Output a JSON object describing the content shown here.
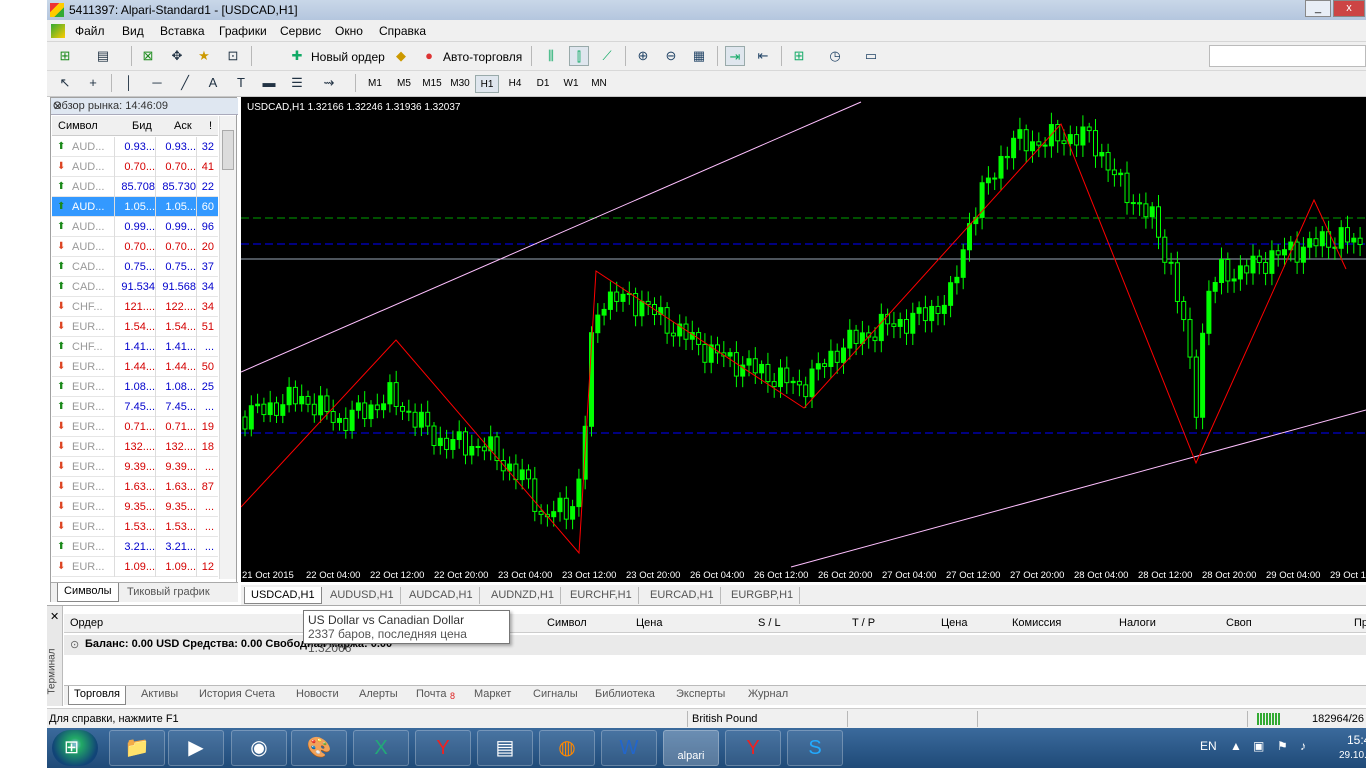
{
  "window": {
    "title": "5411397: Alpari-Standard1 - [USDCAD,H1]",
    "min": "_",
    "close": "x"
  },
  "menu": [
    "Файл",
    "Вид",
    "Вставка",
    "Графики",
    "Сервис",
    "Окно",
    "Справка"
  ],
  "toolbar": {
    "new_order": "Новый ордер",
    "auto_trading": "Авто-торговля"
  },
  "timeframes": [
    "M1",
    "M5",
    "M15",
    "M30",
    "H1",
    "H4",
    "D1",
    "W1",
    "MN"
  ],
  "active_timeframe": "H1",
  "market_watch": {
    "title": "Обзор рынка: 14:46:09",
    "cols": {
      "symbol": "Символ",
      "bid": "Бид",
      "ask": "Аск",
      "spread": "!"
    },
    "rows": [
      {
        "dir": "up",
        "sym": "AUD...",
        "bid": "0.93...",
        "ask": "0.93...",
        "sp": "32",
        "color": "blue"
      },
      {
        "dir": "dn",
        "sym": "AUD...",
        "bid": "0.70...",
        "ask": "0.70...",
        "sp": "41",
        "color": "red"
      },
      {
        "dir": "up",
        "sym": "AUD...",
        "bid": "85.708",
        "ask": "85.730",
        "sp": "22",
        "color": "blue"
      },
      {
        "dir": "up",
        "sym": "AUD...",
        "bid": "1.05...",
        "ask": "1.05...",
        "sp": "60",
        "color": "blue",
        "selected": true
      },
      {
        "dir": "up",
        "sym": "AUD...",
        "bid": "0.99...",
        "ask": "0.99...",
        "sp": "96",
        "color": "blue"
      },
      {
        "dir": "dn",
        "sym": "AUD...",
        "bid": "0.70...",
        "ask": "0.70...",
        "sp": "20",
        "color": "red"
      },
      {
        "dir": "up",
        "sym": "CAD...",
        "bid": "0.75...",
        "ask": "0.75...",
        "sp": "37",
        "color": "blue"
      },
      {
        "dir": "up",
        "sym": "CAD...",
        "bid": "91.534",
        "ask": "91.568",
        "sp": "34",
        "color": "blue"
      },
      {
        "dir": "dn",
        "sym": "CHF...",
        "bid": "121....",
        "ask": "122....",
        "sp": "34",
        "color": "red"
      },
      {
        "dir": "dn",
        "sym": "EUR...",
        "bid": "1.54...",
        "ask": "1.54...",
        "sp": "51",
        "color": "red"
      },
      {
        "dir": "up",
        "sym": "CHF...",
        "bid": "1.41...",
        "ask": "1.41...",
        "sp": "...",
        "color": "blue"
      },
      {
        "dir": "dn",
        "sym": "EUR...",
        "bid": "1.44...",
        "ask": "1.44...",
        "sp": "50",
        "color": "red"
      },
      {
        "dir": "up",
        "sym": "EUR...",
        "bid": "1.08...",
        "ask": "1.08...",
        "sp": "25",
        "color": "blue"
      },
      {
        "dir": "up",
        "sym": "EUR...",
        "bid": "7.45...",
        "ask": "7.45...",
        "sp": "...",
        "color": "blue"
      },
      {
        "dir": "dn",
        "sym": "EUR...",
        "bid": "0.71...",
        "ask": "0.71...",
        "sp": "19",
        "color": "red"
      },
      {
        "dir": "dn",
        "sym": "EUR...",
        "bid": "132....",
        "ask": "132....",
        "sp": "18",
        "color": "red"
      },
      {
        "dir": "dn",
        "sym": "EUR...",
        "bid": "9.39...",
        "ask": "9.39...",
        "sp": "...",
        "color": "red"
      },
      {
        "dir": "dn",
        "sym": "EUR...",
        "bid": "1.63...",
        "ask": "1.63...",
        "sp": "87",
        "color": "red"
      },
      {
        "dir": "dn",
        "sym": "EUR...",
        "bid": "9.35...",
        "ask": "9.35...",
        "sp": "...",
        "color": "red"
      },
      {
        "dir": "dn",
        "sym": "EUR...",
        "bid": "1.53...",
        "ask": "1.53...",
        "sp": "...",
        "color": "red"
      },
      {
        "dir": "up",
        "sym": "EUR...",
        "bid": "3.21...",
        "ask": "3.21...",
        "sp": "...",
        "color": "blue"
      },
      {
        "dir": "dn",
        "sym": "EUR...",
        "bid": "1.09...",
        "ask": "1.09...",
        "sp": "12",
        "color": "red"
      }
    ],
    "tabs": [
      "Символы",
      "Тиковый график"
    ]
  },
  "chart": {
    "header": "USDCAD,H1  1.32166 1.32246 1.31936 1.32037",
    "x_labels": [
      "21 Oct 2015",
      "22 Oct 04:00",
      "22 Oct 12:00",
      "22 Oct 20:00",
      "23 Oct 04:00",
      "23 Oct 12:00",
      "23 Oct 20:00",
      "26 Oct 04:00",
      "26 Oct 12:00",
      "26 Oct 20:00",
      "27 Oct 04:00",
      "27 Oct 12:00",
      "27 Oct 20:00",
      "28 Oct 04:00",
      "28 Oct 12:00",
      "28 Oct 20:00",
      "29 Oct 04:00",
      "29 Oct 1"
    ],
    "colors": {
      "bg": "#000000",
      "candle": "#00ff00",
      "zigzag": "#ff0000",
      "channel": "#ffc0ff",
      "level_green": "#00a000",
      "level_blue": "#0000ff",
      "price_line": "#9aa9b8"
    }
  },
  "chart_tabs": [
    "USDCAD,H1",
    "AUDUSD,H1",
    "AUDCAD,H1",
    "AUDNZD,H1",
    "EURCHF,H1",
    "EURCAD,H1",
    "EURGBP,H1"
  ],
  "tooltip": {
    "line1": "US Dollar vs Canadian Dollar",
    "line2": "2337 баров, последняя цена 1.32066"
  },
  "terminal": {
    "side_label": "Терминал",
    "cols": [
      "Ордер",
      "Символ",
      "Цена",
      "S / L",
      "T / P",
      "Цена",
      "Комиссия",
      "Налоги",
      "Своп",
      "Пр"
    ],
    "balance": "Баланс: 0.00 USD  Средства: 0.00  Свободная маржа: 0.00",
    "tabs": [
      "Торговля",
      "Активы",
      "История Счета",
      "Новости",
      "Алерты",
      "Почта",
      "Маркет",
      "Сигналы",
      "Библиотека",
      "Эксперты",
      "Журнал"
    ],
    "mail_badge": "8"
  },
  "status": {
    "help": "Для справки, нажмите F1",
    "profile": "British Pound",
    "traffic": "182964/26"
  },
  "taskbar": {
    "lang": "EN",
    "time": "15:4",
    "date": "29.10."
  }
}
